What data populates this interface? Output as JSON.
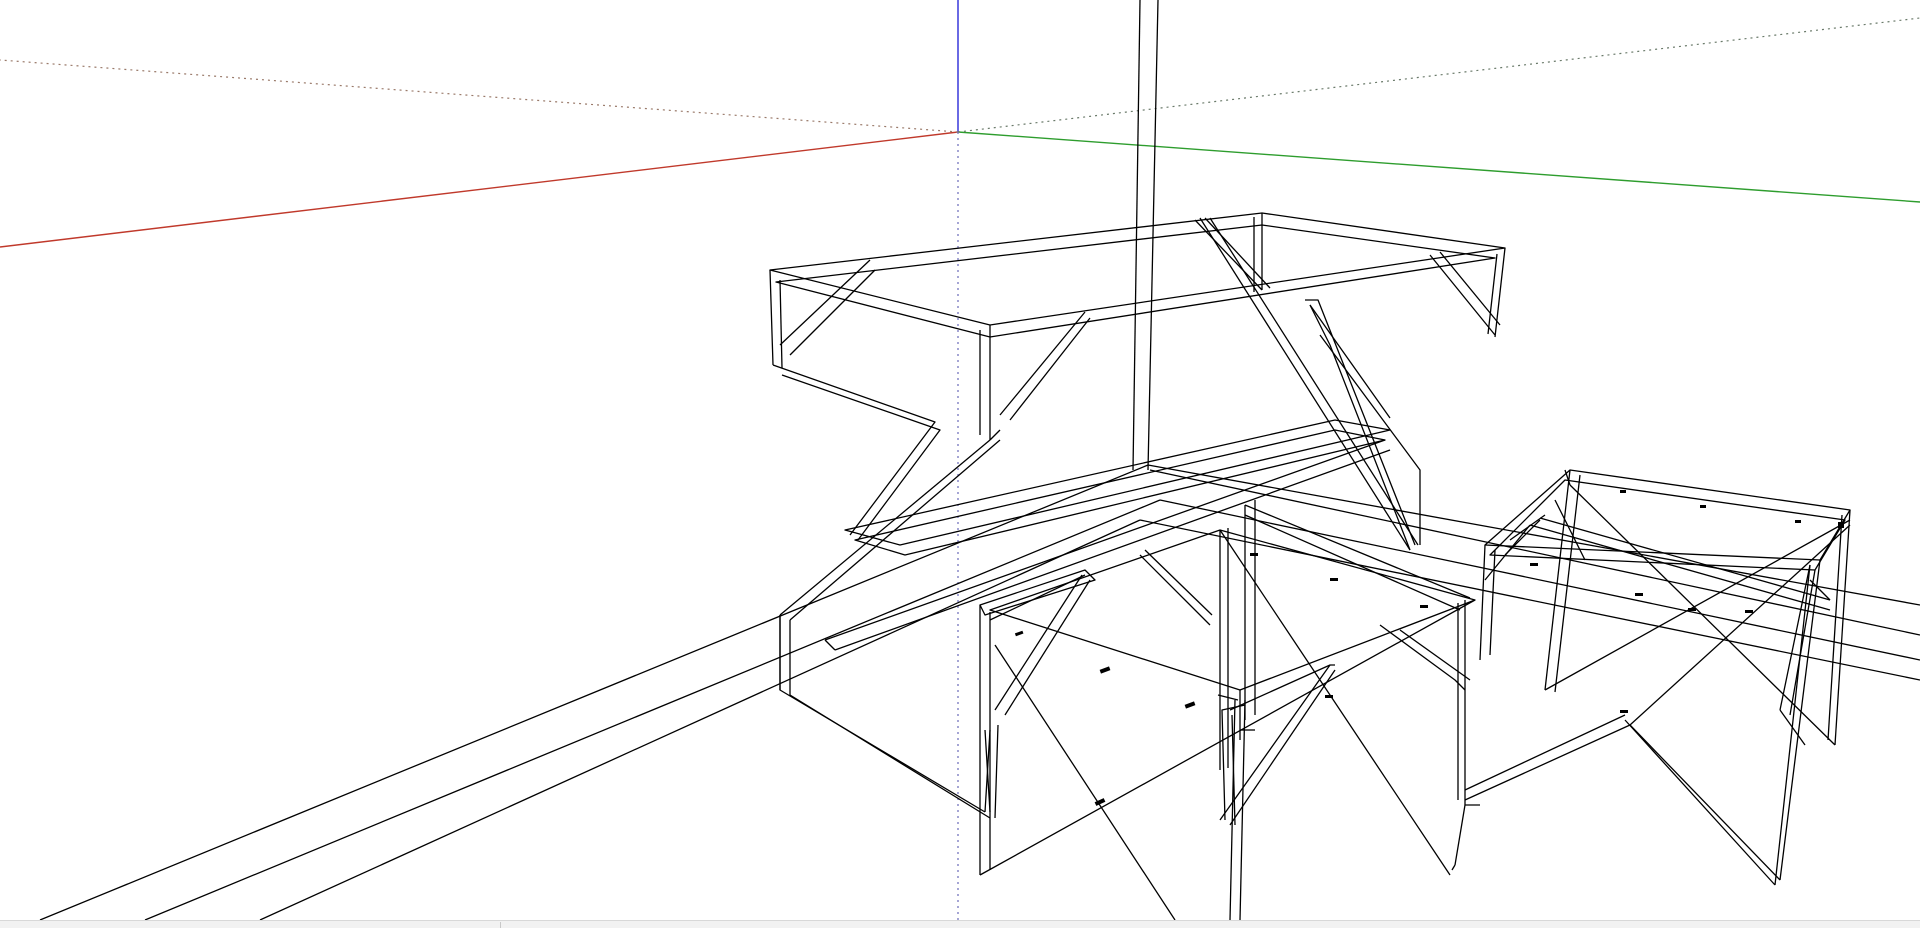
{
  "app": {
    "view": "wireframe-perspective",
    "background_color": "#ffffff"
  },
  "colors": {
    "edge": "#000000",
    "red_axis": "#c0392b",
    "green_axis": "#2e9d2e",
    "blue_axis": "#2b2bd9",
    "dotted_axis": "#8a7a6a",
    "statusbar_bg": "#f2f2f2"
  },
  "model": {
    "description_icon": "wireframe-frames-icon",
    "objects": [
      "desk-frame-large",
      "desk-frame-center",
      "desk-frame-right",
      "floor-rails"
    ]
  }
}
